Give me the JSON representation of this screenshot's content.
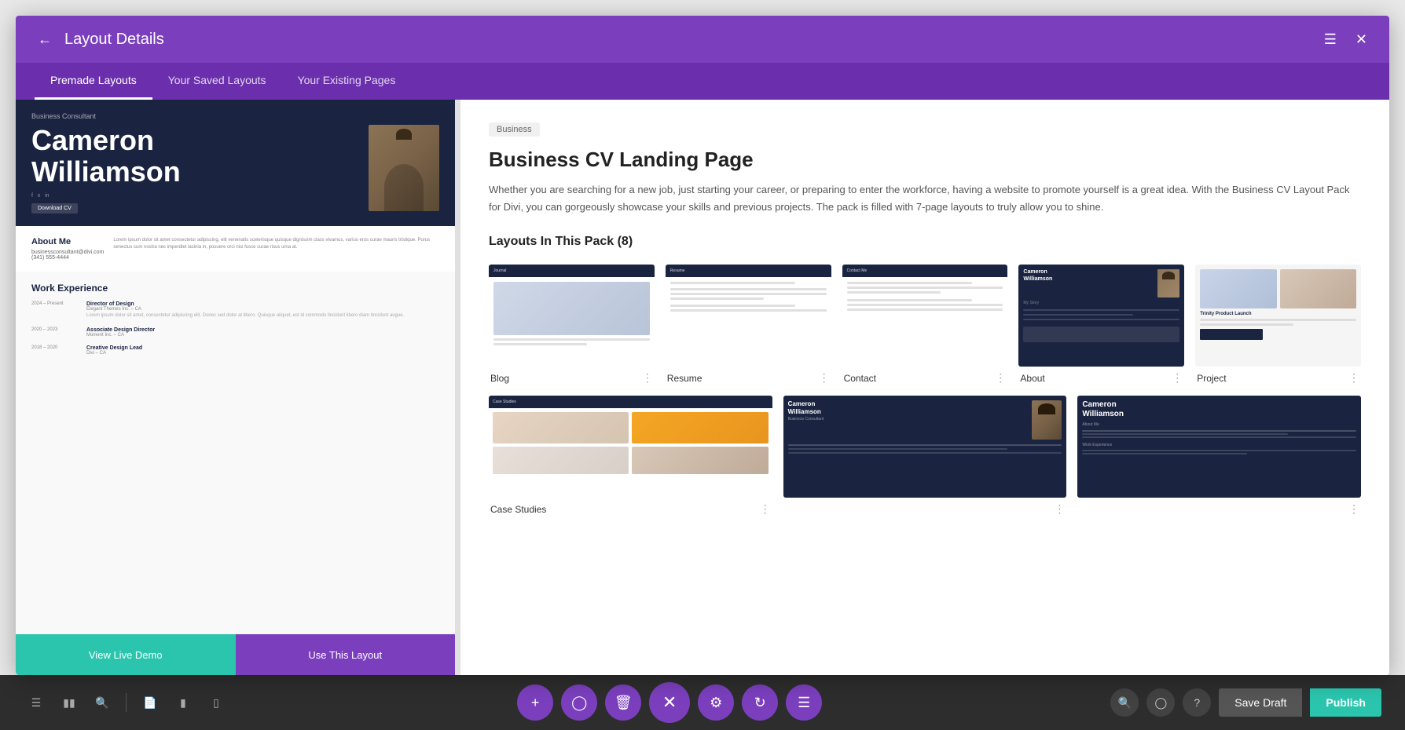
{
  "modal": {
    "title": "Layout Details",
    "tabs": [
      {
        "id": "premade",
        "label": "Premade Layouts"
      },
      {
        "id": "saved",
        "label": "Your Saved Layouts"
      },
      {
        "id": "existing",
        "label": "Your Existing Pages"
      }
    ],
    "active_tab": "premade"
  },
  "layout": {
    "category": "Business",
    "title": "Business CV Landing Page",
    "description": "Whether you are searching for a new job, just starting your career, or preparing to enter the workforce, having a website to promote yourself is a great idea. With the Business CV Layout Pack for Divi, you can gorgeously showcase your skills and previous projects. The pack is filled with 7-page layouts to truly allow you to shine.",
    "pack_label": "Layouts In This Pack (8)",
    "thumbnails": [
      {
        "id": "blog",
        "label": "Blog"
      },
      {
        "id": "resume",
        "label": "Resume"
      },
      {
        "id": "contact",
        "label": "Contact"
      },
      {
        "id": "about",
        "label": "About"
      },
      {
        "id": "project",
        "label": "Project"
      },
      {
        "id": "case-studies",
        "label": "Case Studies"
      },
      {
        "id": "cv-hat",
        "label": ""
      },
      {
        "id": "cv-dark",
        "label": ""
      }
    ]
  },
  "preview": {
    "cv_name": "Cameron Williamson",
    "cv_label": "Business Consultant",
    "cv_about_title": "About Me",
    "cv_work_title": "Work Experience",
    "btn_demo": "View Live Demo",
    "btn_use": "Use This Layout"
  },
  "bottom_toolbar": {
    "btn_save_draft": "Save Draft",
    "btn_publish": "Publish"
  }
}
